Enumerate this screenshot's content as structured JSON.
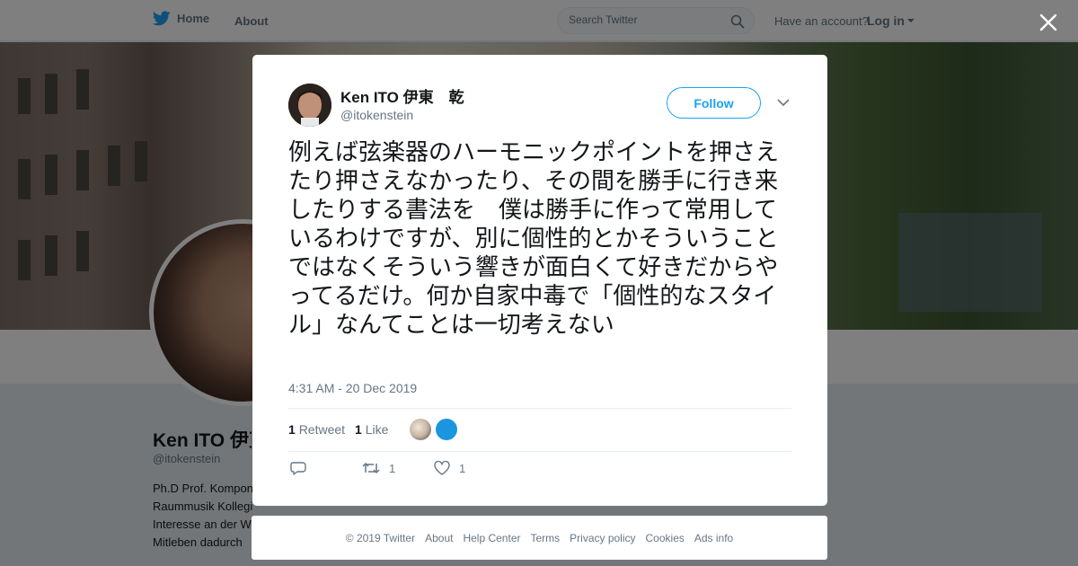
{
  "colors": {
    "accent": "#1da1f2",
    "text": "#14171a",
    "muted": "#657786"
  },
  "nav": {
    "home_label": "Home",
    "about_label": "About",
    "search_placeholder": "Search Twitter",
    "have_account": "Have an account?",
    "login_label": "Log in"
  },
  "profile": {
    "name": "Ken ITO 伊東　乾",
    "handle": "@itokenstein",
    "bio_lines": [
      "Ph.D Prof. Komponist/ Dirigent",
      "Raummusik Kollegium Berlin. Habe viele",
      "Interesse an der Wissenschaft,",
      "Mitleben dadurch"
    ]
  },
  "tweet": {
    "author_name": "Ken ITO 伊東　乾",
    "author_handle": "@itokenstein",
    "follow_label": "Follow",
    "text": "例えば弦楽器のハーモニックポイントを押さえたり押さえなかったり、その間を勝手に行き来したりする書法を　僕は勝手に作って常用しているわけですが、別に個性的とかそういうことではなくそういう響きが面白くて好きだからやってるだけ。何か自家中毒で「個性的なスタイル」なんてことは一切考えない",
    "timestamp": "4:31 AM - 20 Dec 2019",
    "retweet_count": "1",
    "retweet_label": "Retweet",
    "like_count": "1",
    "like_label": "Like",
    "action_retweet_count": "1",
    "action_like_count": "1"
  },
  "footer": {
    "links": [
      "© 2019 Twitter",
      "About",
      "Help Center",
      "Terms",
      "Privacy policy",
      "Cookies",
      "Ads info"
    ]
  }
}
